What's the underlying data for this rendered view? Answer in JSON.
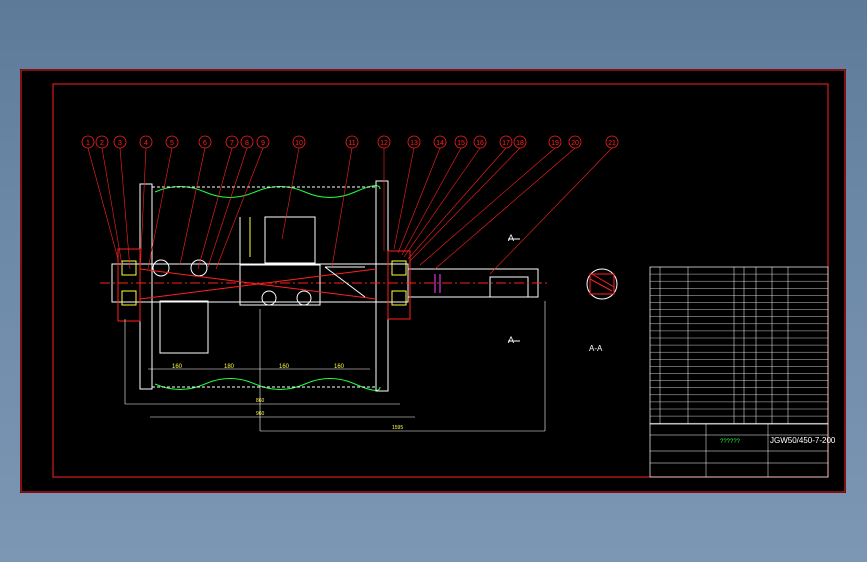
{
  "balloons": [
    "1",
    "2",
    "3",
    "4",
    "5",
    "6",
    "7",
    "8",
    "9",
    "10",
    "11",
    "12",
    "13",
    "14",
    "15",
    "16",
    "17",
    "18",
    "19",
    "20",
    "21"
  ],
  "dimensions": {
    "d160a": "160",
    "d180": "180",
    "d160b": "160",
    "d160c": "160",
    "overall1": "860",
    "overall2": "960",
    "overall3": "1595"
  },
  "section": {
    "marker_top": "A",
    "marker_bottom": "A",
    "label": "A-A"
  },
  "title_block": {
    "drawing_no": "JGW50/450-7-200",
    "name": "??????"
  },
  "colors": {
    "frame": "#ff2020",
    "outline": "#ffffff",
    "green": "#20ff40",
    "yellow": "#ffff40",
    "magenta": "#ff40ff",
    "cyan": "#40ffff"
  }
}
